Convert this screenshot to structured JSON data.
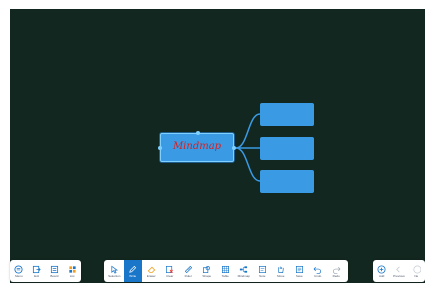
{
  "canvas": {
    "background": "#12271f"
  },
  "mindmap": {
    "central_label": "Mindmap",
    "node_color": "#3a9ae4",
    "connector_color": "#3a9ae4",
    "text_color": "#d81f1f"
  },
  "toolbar_left": [
    {
      "label": "Menu",
      "icon": "menu-icon"
    },
    {
      "label": "Exit",
      "icon": "exit-icon"
    },
    {
      "label": "Board",
      "icon": "board-icon"
    },
    {
      "label": "List",
      "icon": "list-icon"
    }
  ],
  "toolbar_center": [
    {
      "label": "Selection",
      "icon": "cursor-icon"
    },
    {
      "label": "Write",
      "icon": "pen-icon",
      "active": true
    },
    {
      "label": "Eraser",
      "icon": "eraser-icon"
    },
    {
      "label": "Clear",
      "icon": "clear-icon"
    },
    {
      "label": "Ruler",
      "icon": "ruler-icon"
    },
    {
      "label": "Shape",
      "icon": "shape-icon"
    },
    {
      "label": "Table",
      "icon": "table-icon"
    },
    {
      "label": "Mindmap",
      "icon": "mindmap-icon"
    },
    {
      "label": "Note",
      "icon": "note-icon"
    },
    {
      "label": "Move",
      "icon": "hand-icon"
    },
    {
      "label": "Save",
      "icon": "save-icon"
    },
    {
      "label": "Undo",
      "icon": "undo-icon"
    },
    {
      "label": "Redo",
      "icon": "redo-icon"
    }
  ],
  "toolbar_right": [
    {
      "label": "Add",
      "icon": "add-icon"
    },
    {
      "label": "Previous",
      "icon": "chevron-left-icon"
    },
    {
      "label": "Ne",
      "icon": "next-icon"
    }
  ]
}
